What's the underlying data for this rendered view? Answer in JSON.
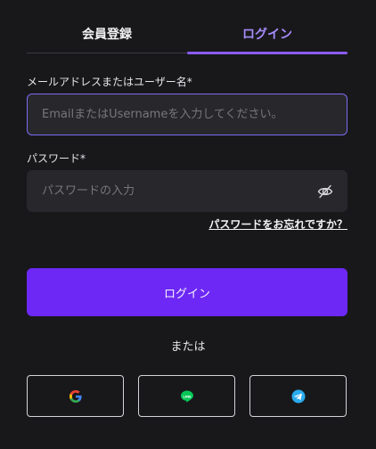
{
  "tabs": {
    "register": "会員登録",
    "login": "ログイン"
  },
  "email": {
    "label": "メールアドレスまたはユーザー名",
    "required_mark": "*",
    "placeholder": "EmailまたはUsernameを入力してください。"
  },
  "password": {
    "label": "パスワード",
    "required_mark": "*",
    "placeholder": "パスワードの入力"
  },
  "forgot_link": "パスワードをお忘れですか？",
  "login_button": "ログイン",
  "divider_text": "または",
  "social": [
    {
      "name": "google-icon"
    },
    {
      "name": "line-icon"
    },
    {
      "name": "telegram-icon"
    }
  ],
  "colors": {
    "background": "#18181b",
    "accent": "#6d28f5",
    "active_tab": "#a78bfa"
  }
}
